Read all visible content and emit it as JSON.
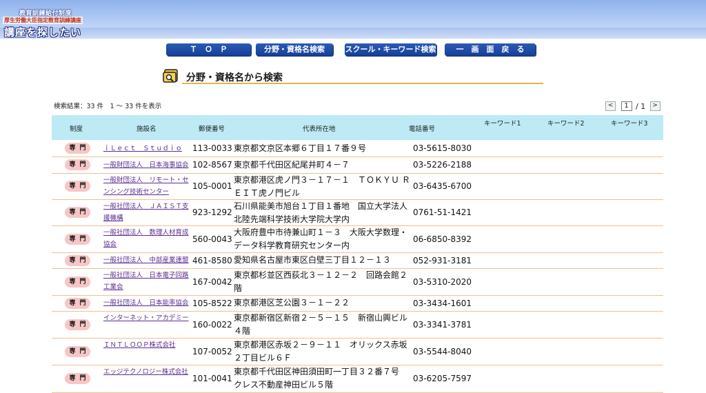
{
  "header": {
    "line1": "教育訓練給付制度",
    "line2": "厚生労働大臣指定教育訓練講座",
    "title": "講座を探したい"
  },
  "nav": {
    "top": "Ｔ　Ｏ　Ｐ",
    "field_search": "分野・資格名検索",
    "school_search": "スクール・キーワード検索",
    "back": "一　画　面　戻　る"
  },
  "section": {
    "title": "分野・資格名から検索"
  },
  "results": {
    "summary": "検索結果：33 件　1 〜 33 件を表示"
  },
  "pager": {
    "prev": "<",
    "page": "1",
    "total": "/ 1",
    "next": ">"
  },
  "table": {
    "headers": {
      "system": "制度",
      "facility": "施設名",
      "zip": "郵便番号",
      "address": "代表所在地",
      "tel": "電話番号",
      "kw1": "キーワード1",
      "kw2": "キーワード2",
      "kw3": "キーワード3"
    },
    "badge": "専門",
    "rows": [
      {
        "facility": "ｉＬｅｃｔ　Ｓｔｕｄｉｏ",
        "zip": "113-0033",
        "address": "東京都文京区本郷６丁目１７番９号",
        "tel": "03-5615-8030"
      },
      {
        "facility": "一般財団法人　日本海事協会",
        "zip": "102-8567",
        "address": "東京都千代田区紀尾井町４－７",
        "tel": "03-5226-2188"
      },
      {
        "facility": "一般財団法人　リモート・センシング技術センター",
        "zip": "105-0001",
        "address": "東京都港区虎ノ門３－１７－１　ＴＯＫＹＵ ＲＥＩＴ虎ノ門ビル",
        "tel": "03-6435-6700"
      },
      {
        "facility": "一般社団法人　ＪＡＩＳＴ支援機構",
        "zip": "923-1292",
        "address": "石川県能美市旭台１丁目１番地　国立大学法人北陸先端科学技術大学院大学内",
        "tel": "0761-51-1421"
      },
      {
        "facility": "一般社団法人　数理人材育成協会",
        "zip": "560-0043",
        "address": "大阪府豊中市待兼山町１－３　大阪大学数理・データ科学教育研究センター内",
        "tel": "06-6850-8392"
      },
      {
        "facility": "一般社団法人　中部産業連盟",
        "zip": "461-8580",
        "address": "愛知県名古屋市東区白壁三丁目１２－１３",
        "tel": "052-931-3181"
      },
      {
        "facility": "一般社団法人　日本電子回路工業会",
        "zip": "167-0042",
        "address": "東京都杉並区西荻北３－１２－２　回路会館２階",
        "tel": "03-5310-2020"
      },
      {
        "facility": "一般社団法人　日本能率協会",
        "zip": "105-8522",
        "address": "東京都港区芝公園３－１－２２",
        "tel": "03-3434-1601"
      },
      {
        "facility": "インターネット・アカデミー",
        "zip": "160-0022",
        "address": "東京都新宿区新宿２－５－１５　新宿山興ビル４階",
        "tel": "03-3341-3781"
      },
      {
        "facility": "ＩＮＴＬＯＯＰ株式会社",
        "zip": "107-0052",
        "address": "東京都港区赤坂２－９－１１　オリックス赤坂２丁目ビル６Ｆ",
        "tel": "03-5544-8040"
      },
      {
        "facility": "エッジテクノロジー株式会社",
        "zip": "101-0041",
        "address": "東京都千代田区神田須田町一丁目３２番７号　クレス不動産神田ビル５階",
        "tel": "03-6205-7597"
      }
    ]
  }
}
